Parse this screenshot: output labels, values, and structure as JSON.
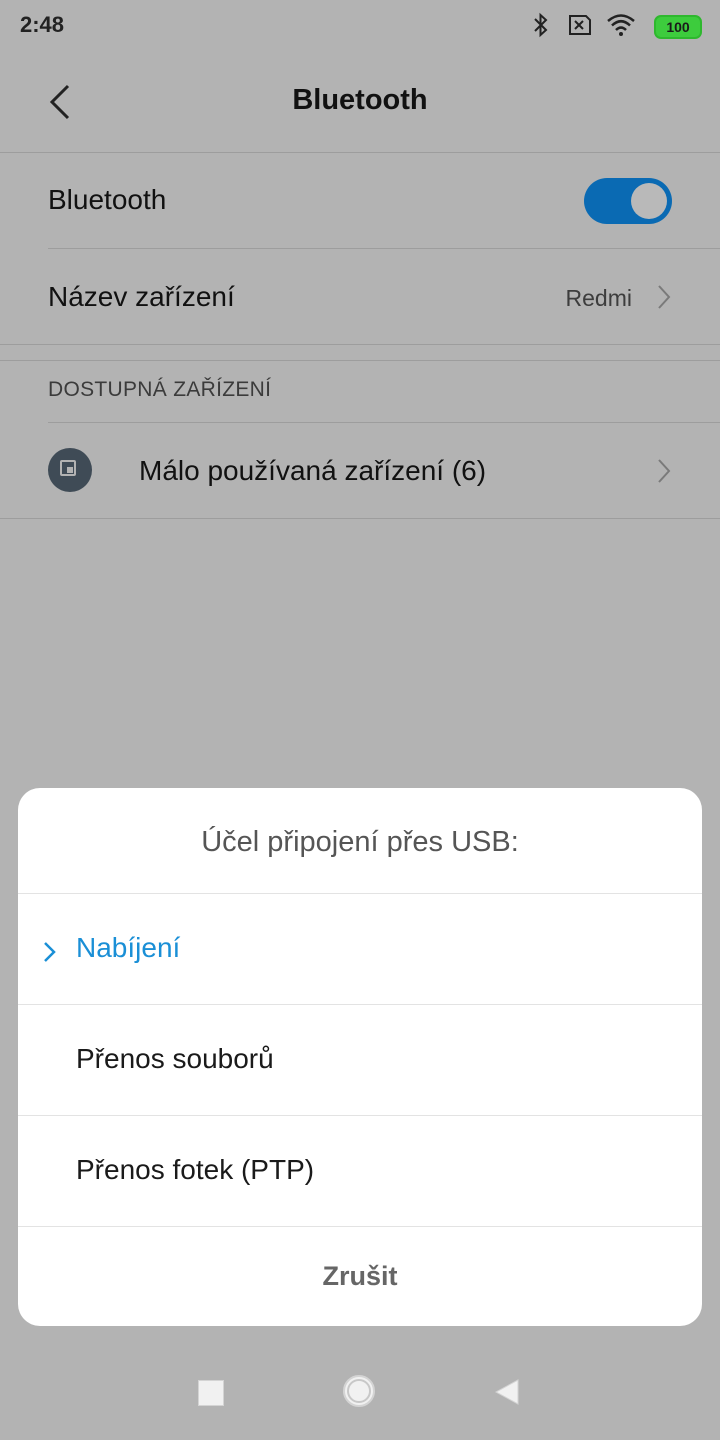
{
  "status_bar": {
    "time": "2:48",
    "battery": "100",
    "icons": [
      "bluetooth-icon",
      "no-sim-icon",
      "wifi-icon",
      "battery-icon"
    ]
  },
  "header": {
    "title": "Bluetooth",
    "back_icon": "chevron-left-icon"
  },
  "settings": {
    "bluetooth_label": "Bluetooth",
    "bluetooth_enabled": true,
    "device_name_label": "Název zařízení",
    "device_name_value": "Redmi",
    "section_header": "DOSTUPNÁ ZAŘÍZENÍ",
    "rare_devices_label": "Málo používaná zařízení (6)"
  },
  "dialog": {
    "title": "Účel připojení přes USB:",
    "options": [
      {
        "label": "Nabíjení",
        "selected": true
      },
      {
        "label": "Přenos souborů",
        "selected": false
      },
      {
        "label": "Přenos fotek (PTP)",
        "selected": false
      }
    ],
    "cancel_label": "Zrušit"
  },
  "colors": {
    "accent": "#1a8fd6",
    "toggle_on": "#0a6ab3",
    "scrim_background": "#b3b3b3"
  }
}
